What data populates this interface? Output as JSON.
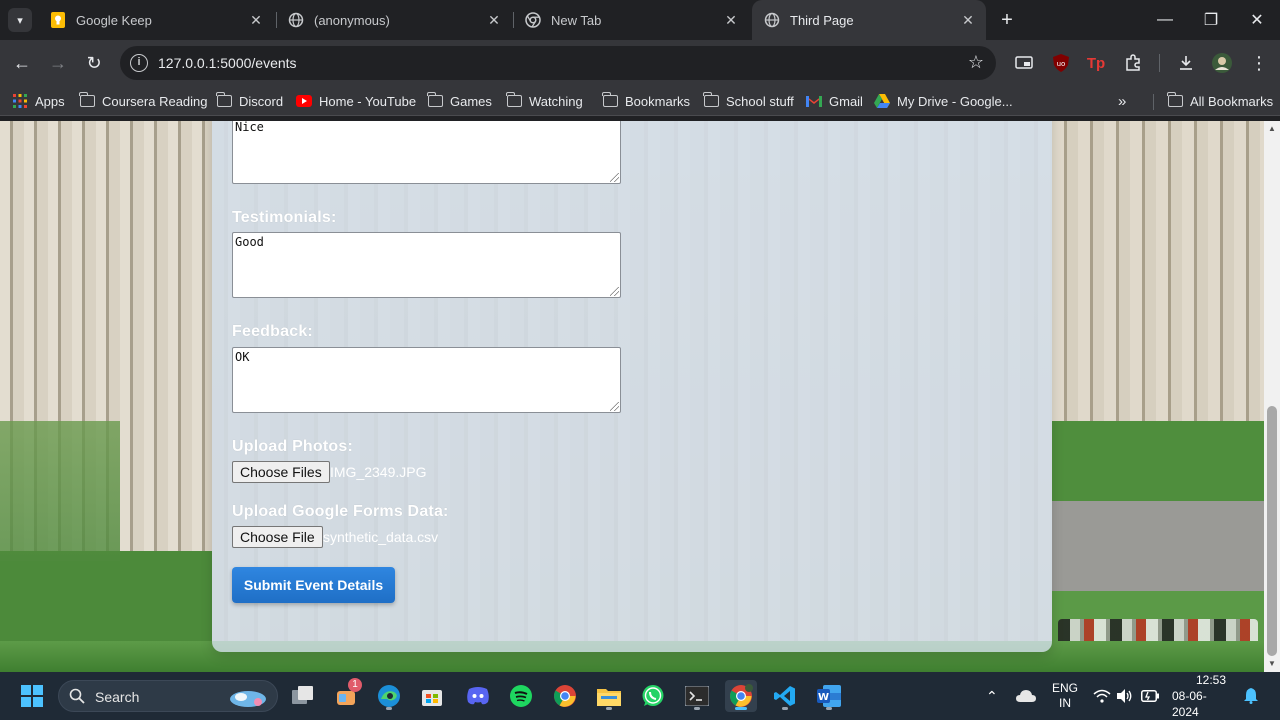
{
  "browser": {
    "tabs": [
      {
        "title": "Google Keep",
        "icon": "google-keep-icon",
        "active": false
      },
      {
        "title": "(anonymous)",
        "icon": "globe-icon",
        "active": false
      },
      {
        "title": "New Tab",
        "icon": "chrome-icon",
        "active": false
      },
      {
        "title": "Third Page",
        "icon": "globe-icon",
        "active": true
      }
    ],
    "url": "127.0.0.1:5000/events",
    "bookmarks": [
      {
        "label": "Apps",
        "icon": "apps-grid-icon"
      },
      {
        "label": "Coursera Reading",
        "icon": "folder-icon"
      },
      {
        "label": "Discord",
        "icon": "folder-icon"
      },
      {
        "label": "Home - YouTube",
        "icon": "youtube-icon"
      },
      {
        "label": "Games",
        "icon": "folder-icon"
      },
      {
        "label": "Watching",
        "icon": "folder-icon"
      },
      {
        "label": "Bookmarks",
        "icon": "folder-icon"
      },
      {
        "label": "School stuff",
        "icon": "folder-icon"
      },
      {
        "label": "Gmail",
        "icon": "gmail-icon"
      },
      {
        "label": "My Drive - Google...",
        "icon": "google-drive-icon"
      }
    ],
    "all_bookmarks": "All Bookmarks"
  },
  "form": {
    "first_textarea_value": "Nice",
    "testimonials_label": "Testimonials:",
    "testimonials_value": "Good",
    "feedback_label": "Feedback:",
    "feedback_value": "OK",
    "photos_label": "Upload Photos:",
    "photos_button": "Choose Files",
    "photos_file": "IMG_2349.JPG",
    "forms_label": "Upload Google Forms Data:",
    "forms_button": "Choose File",
    "forms_file": "synthetic_data.csv",
    "submit_label": "Submit Event Details"
  },
  "taskbar": {
    "search_placeholder": "Search",
    "notification_badge": "1",
    "language": "ENG",
    "region": "IN",
    "time": "12:53",
    "date": "08-06-2024"
  },
  "colors": {
    "submit_button": "#2f86e0",
    "panel": "#d6e2ee",
    "chrome_dark": "#202124"
  }
}
